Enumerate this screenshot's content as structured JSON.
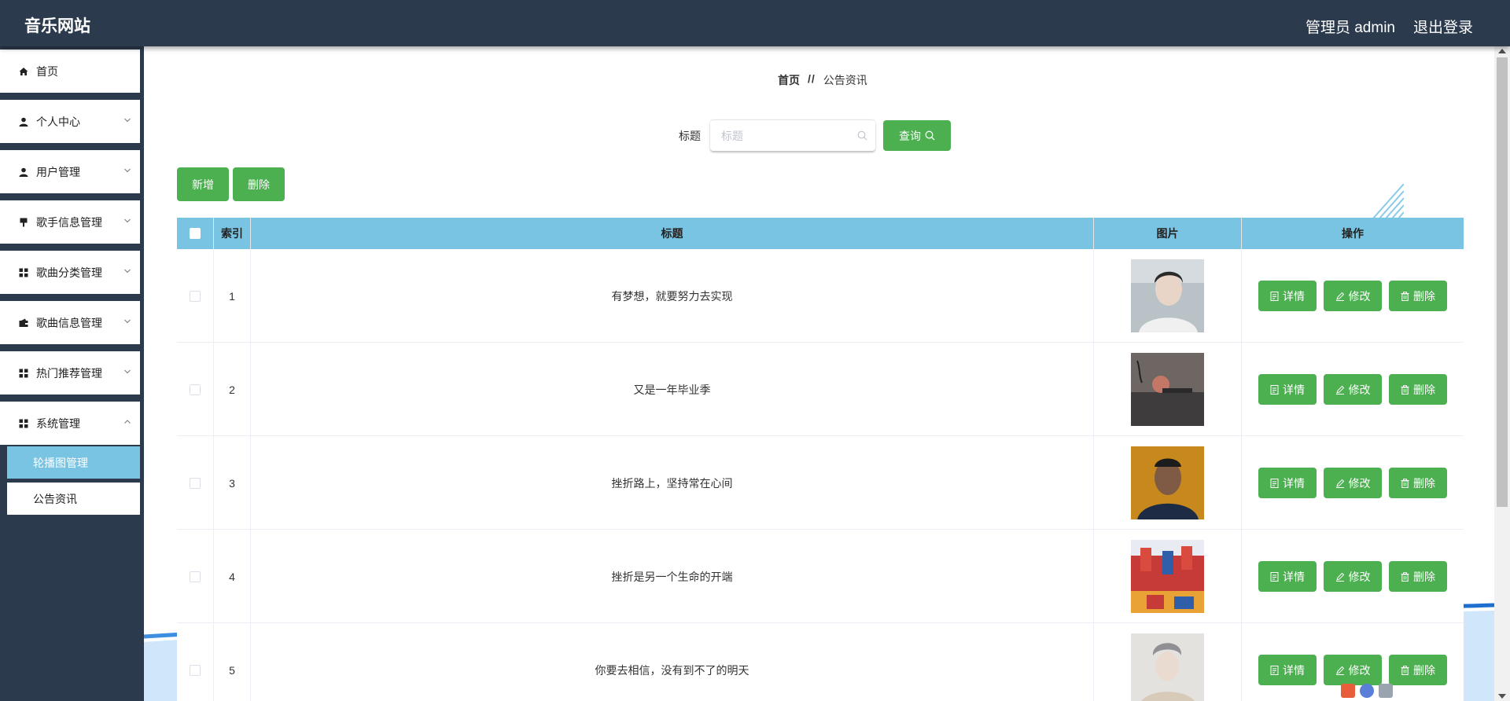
{
  "app": {
    "title": "音乐网站",
    "user_label": "管理员 admin",
    "logout_label": "退出登录"
  },
  "sidebar": {
    "items": [
      {
        "label": "首页",
        "icon": "home-icon",
        "has_arrow": false
      },
      {
        "label": "个人中心",
        "icon": "user-icon",
        "has_arrow": true
      },
      {
        "label": "用户管理",
        "icon": "user-icon",
        "has_arrow": true
      },
      {
        "label": "歌手信息管理",
        "icon": "pin-icon",
        "has_arrow": true
      },
      {
        "label": "歌曲分类管理",
        "icon": "grid-icon",
        "has_arrow": true
      },
      {
        "label": "歌曲信息管理",
        "icon": "wallet-icon",
        "has_arrow": true
      },
      {
        "label": "热门推荐管理",
        "icon": "grid-icon",
        "has_arrow": true
      },
      {
        "label": "系统管理",
        "icon": "grid-icon",
        "has_arrow": true
      }
    ],
    "submenu": [
      {
        "label": "轮播图管理",
        "active": true
      },
      {
        "label": "公告资讯",
        "active": false
      }
    ]
  },
  "breadcrumb": {
    "home": "首页",
    "separator": "//",
    "current": "公告资讯"
  },
  "search": {
    "label": "标题",
    "placeholder": "标题",
    "value": "",
    "button_label": "查询"
  },
  "actions": {
    "add_label": "新增",
    "delete_label": "删除"
  },
  "table": {
    "headers": {
      "index": "索引",
      "title": "标题",
      "image": "图片",
      "actions": "操作"
    },
    "row_actions": {
      "detail": "详情",
      "edit": "修改",
      "delete": "删除"
    },
    "rows": [
      {
        "index": "1",
        "title": "有梦想，就要努力去实现"
      },
      {
        "index": "2",
        "title": "又是一年毕业季"
      },
      {
        "index": "3",
        "title": "挫折路上，坚持常在心间"
      },
      {
        "index": "4",
        "title": "挫折是另一个生命的开端"
      },
      {
        "index": "5",
        "title": "你要去相信，没有到不了的明天"
      }
    ]
  },
  "colors": {
    "header_bg": "#2c3a4d",
    "accent_green": "#4caf50",
    "table_head": "#79c4e3"
  }
}
